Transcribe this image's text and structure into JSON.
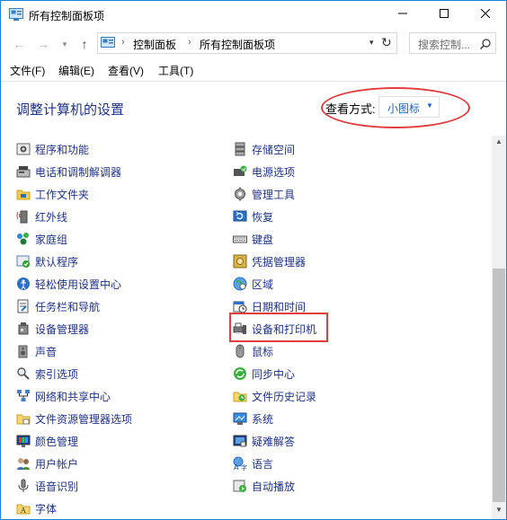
{
  "window": {
    "title": "所有控制面板项"
  },
  "address": {
    "crumbs": [
      "控制面板",
      "所有控制面板项"
    ],
    "search_placeholder": "搜索控制..."
  },
  "menu": [
    "文件(F)",
    "编辑(E)",
    "查看(V)",
    "工具(T)"
  ],
  "page": {
    "heading": "调整计算机的设置",
    "view_label": "查看方式:",
    "view_value": "小图标"
  },
  "items_left": [
    {
      "label": "程序和功能",
      "icon": "programs-icon"
    },
    {
      "label": "电话和调制解调器",
      "icon": "phone-modem-icon"
    },
    {
      "label": "工作文件夹",
      "icon": "work-folders-icon"
    },
    {
      "label": "红外线",
      "icon": "infrared-icon"
    },
    {
      "label": "家庭组",
      "icon": "homegroup-icon"
    },
    {
      "label": "默认程序",
      "icon": "default-programs-icon"
    },
    {
      "label": "轻松使用设置中心",
      "icon": "ease-of-access-icon"
    },
    {
      "label": "任务栏和导航",
      "icon": "taskbar-icon"
    },
    {
      "label": "设备管理器",
      "icon": "device-manager-icon"
    },
    {
      "label": "声音",
      "icon": "sound-icon"
    },
    {
      "label": "索引选项",
      "icon": "indexing-icon"
    },
    {
      "label": "网络和共享中心",
      "icon": "network-icon"
    },
    {
      "label": "文件资源管理器选项",
      "icon": "explorer-options-icon"
    },
    {
      "label": "颜色管理",
      "icon": "color-management-icon"
    },
    {
      "label": "用户帐户",
      "icon": "user-accounts-icon"
    },
    {
      "label": "语音识别",
      "icon": "speech-recognition-icon"
    },
    {
      "label": "字体",
      "icon": "fonts-icon"
    }
  ],
  "items_right": [
    {
      "label": "存储空间",
      "icon": "storage-spaces-icon"
    },
    {
      "label": "电源选项",
      "icon": "power-options-icon"
    },
    {
      "label": "管理工具",
      "icon": "admin-tools-icon"
    },
    {
      "label": "恢复",
      "icon": "recovery-icon"
    },
    {
      "label": "键盘",
      "icon": "keyboard-icon"
    },
    {
      "label": "凭据管理器",
      "icon": "credential-manager-icon"
    },
    {
      "label": "区域",
      "icon": "region-icon"
    },
    {
      "label": "日期和时间",
      "icon": "date-time-icon"
    },
    {
      "label": "设备和打印机",
      "icon": "devices-printers-icon"
    },
    {
      "label": "鼠标",
      "icon": "mouse-icon"
    },
    {
      "label": "同步中心",
      "icon": "sync-center-icon"
    },
    {
      "label": "文件历史记录",
      "icon": "file-history-icon"
    },
    {
      "label": "系统",
      "icon": "system-icon"
    },
    {
      "label": "疑难解答",
      "icon": "troubleshooting-icon"
    },
    {
      "label": "语言",
      "icon": "language-icon"
    },
    {
      "label": "自动播放",
      "icon": "autoplay-icon"
    }
  ],
  "colors": {
    "link": "#1e3287",
    "highlight": "#e23c3c",
    "accent": "#1883d7"
  }
}
